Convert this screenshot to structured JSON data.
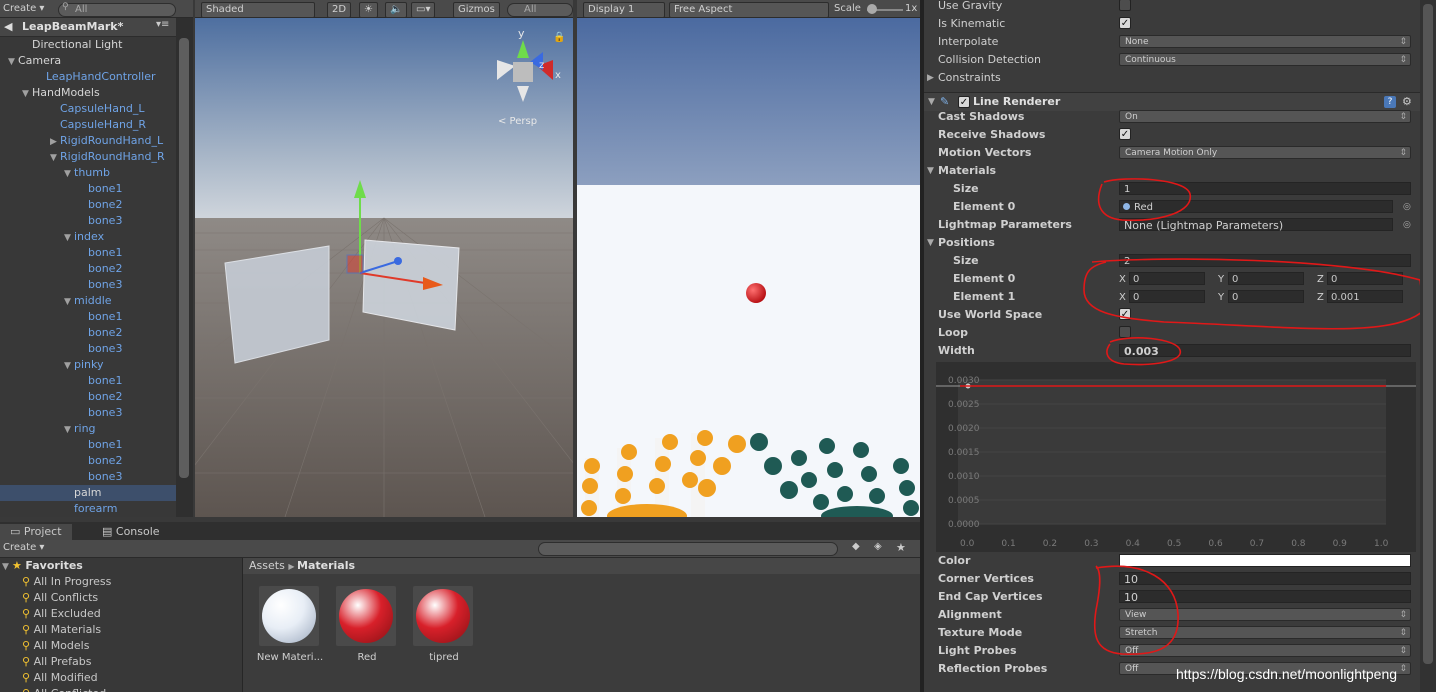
{
  "hierarchy": {
    "create_label": "Create ▾",
    "search_placeholder": "All",
    "scene_name": "LeapBeamMark*",
    "items": [
      {
        "label": "Directional Light",
        "depth": 1,
        "style": "white",
        "arrow": ""
      },
      {
        "label": "Camera",
        "depth": 0,
        "style": "white",
        "arrow": "▼"
      },
      {
        "label": "LeapHandController",
        "depth": 2,
        "style": "blue",
        "arrow": ""
      },
      {
        "label": "HandModels",
        "depth": 1,
        "style": "white",
        "arrow": "▼"
      },
      {
        "label": "CapsuleHand_L",
        "depth": 3,
        "style": "blue",
        "arrow": ""
      },
      {
        "label": "CapsuleHand_R",
        "depth": 3,
        "style": "blue",
        "arrow": ""
      },
      {
        "label": "RigidRoundHand_L",
        "depth": 3,
        "style": "blue",
        "arrow": "▶"
      },
      {
        "label": "RigidRoundHand_R",
        "depth": 3,
        "style": "blue",
        "arrow": "▼"
      },
      {
        "label": "thumb",
        "depth": 4,
        "style": "blue",
        "arrow": "▼"
      },
      {
        "label": "bone1",
        "depth": 5,
        "style": "blue",
        "arrow": ""
      },
      {
        "label": "bone2",
        "depth": 5,
        "style": "blue",
        "arrow": ""
      },
      {
        "label": "bone3",
        "depth": 5,
        "style": "blue",
        "arrow": ""
      },
      {
        "label": "index",
        "depth": 4,
        "style": "blue",
        "arrow": "▼"
      },
      {
        "label": "bone1",
        "depth": 5,
        "style": "blue",
        "arrow": ""
      },
      {
        "label": "bone2",
        "depth": 5,
        "style": "blue",
        "arrow": ""
      },
      {
        "label": "bone3",
        "depth": 5,
        "style": "blue",
        "arrow": ""
      },
      {
        "label": "middle",
        "depth": 4,
        "style": "blue",
        "arrow": "▼"
      },
      {
        "label": "bone1",
        "depth": 5,
        "style": "blue",
        "arrow": ""
      },
      {
        "label": "bone2",
        "depth": 5,
        "style": "blue",
        "arrow": ""
      },
      {
        "label": "bone3",
        "depth": 5,
        "style": "blue",
        "arrow": ""
      },
      {
        "label": "pinky",
        "depth": 4,
        "style": "blue",
        "arrow": "▼"
      },
      {
        "label": "bone1",
        "depth": 5,
        "style": "blue",
        "arrow": ""
      },
      {
        "label": "bone2",
        "depth": 5,
        "style": "blue",
        "arrow": ""
      },
      {
        "label": "bone3",
        "depth": 5,
        "style": "blue",
        "arrow": ""
      },
      {
        "label": "ring",
        "depth": 4,
        "style": "blue",
        "arrow": "▼"
      },
      {
        "label": "bone1",
        "depth": 5,
        "style": "blue",
        "arrow": ""
      },
      {
        "label": "bone2",
        "depth": 5,
        "style": "blue",
        "arrow": ""
      },
      {
        "label": "bone3",
        "depth": 5,
        "style": "blue",
        "arrow": ""
      },
      {
        "label": "palm",
        "depth": 4,
        "style": "white sel",
        "arrow": ""
      },
      {
        "label": "forearm",
        "depth": 4,
        "style": "blue",
        "arrow": ""
      }
    ]
  },
  "scene": {
    "shading": "Shaded",
    "mode_2d": "2D",
    "gizmos": "Gizmos",
    "search_placeholder": "All",
    "persp_label": "< Persp",
    "axis_y": "y",
    "axis_z": "z",
    "axis_x": "x"
  },
  "game": {
    "display": "Display 1",
    "aspect": "Free Aspect",
    "scale_label": "Scale",
    "scale_value": "1x"
  },
  "inspector": {
    "rigidbody_rows": [
      {
        "label": "Use Gravity",
        "type": "checkbox",
        "checked": false
      },
      {
        "label": "Is Kinematic",
        "type": "checkbox",
        "checked": true
      },
      {
        "label": "Interpolate",
        "type": "dropdown",
        "value": "None"
      },
      {
        "label": "Collision Detection",
        "type": "dropdown",
        "value": "Continuous"
      },
      {
        "label": "Constraints",
        "type": "foldout"
      }
    ],
    "component_title": "Line Renderer",
    "cast_shadows": {
      "label": "Cast Shadows",
      "value": "On"
    },
    "receive_shadows": {
      "label": "Receive Shadows"
    },
    "motion_vectors": {
      "label": "Motion Vectors",
      "value": "Camera Motion Only"
    },
    "materials": {
      "label": "Materials",
      "size_label": "Size",
      "size": "1",
      "element_label": "Element 0",
      "element_value": "Red"
    },
    "lightmap": {
      "label": "Lightmap Parameters",
      "value": "None (Lightmap Parameters)"
    },
    "positions": {
      "label": "Positions",
      "size_label": "Size",
      "size": "2",
      "elements": [
        {
          "label": "Element 0",
          "x": "0",
          "y": "0",
          "z": "0"
        },
        {
          "label": "Element 1",
          "x": "0",
          "y": "0",
          "z": "0.001"
        }
      ]
    },
    "use_world_space": {
      "label": "Use World Space"
    },
    "loop": {
      "label": "Loop"
    },
    "width": {
      "label": "Width",
      "value": "0.003"
    },
    "curve_y_ticks": [
      "0.0030",
      "0.0025",
      "0.0020",
      "0.0015",
      "0.0010",
      "0.0005",
      "0.0000"
    ],
    "curve_x_ticks": [
      "0.0",
      "0.1",
      "0.2",
      "0.3",
      "0.4",
      "0.5",
      "0.6",
      "0.7",
      "0.8",
      "0.9",
      "1.0"
    ],
    "color_label": "Color",
    "corner_vertices": {
      "label": "Corner Vertices",
      "value": "10"
    },
    "end_cap_vertices": {
      "label": "End Cap Vertices",
      "value": "10"
    },
    "alignment": {
      "label": "Alignment",
      "value": "View"
    },
    "texture_mode": {
      "label": "Texture Mode",
      "value": "Stretch"
    },
    "light_probes": {
      "label": "Light Probes",
      "value": "Off"
    },
    "reflection_probes": {
      "label": "Reflection Probes",
      "value": "Off"
    }
  },
  "project": {
    "tab_project": "Project",
    "tab_console": "Console",
    "create_label": "Create ▾",
    "favorites_label": "Favorites",
    "favorites": [
      "All In Progress",
      "All Conflicts",
      "All Excluded",
      "All Materials",
      "All Models",
      "All Prefabs",
      "All Modified",
      "All Conflicted"
    ],
    "breadcrumb_root": "Assets",
    "breadcrumb_leaf": "Materials",
    "assets": [
      {
        "name": "New Materi...",
        "color": "#e8eef6"
      },
      {
        "name": "Red",
        "color": "#d8202a"
      },
      {
        "name": "tipred",
        "color": "#d8202a"
      }
    ]
  },
  "watermark": "https://blog.csdn.net/moonlightpeng"
}
